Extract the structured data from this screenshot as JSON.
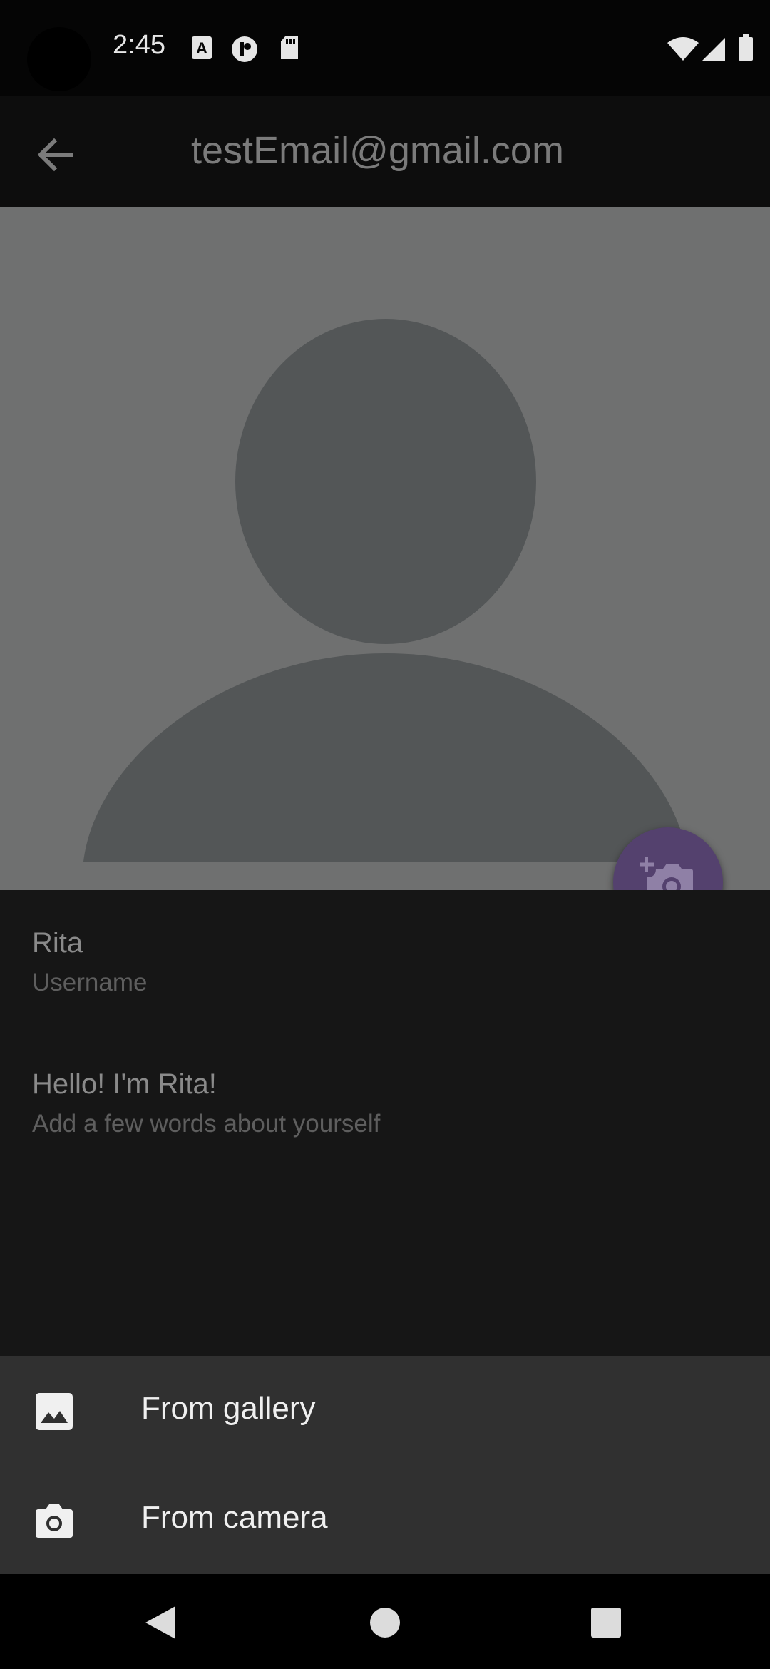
{
  "status_bar": {
    "time": "2:45",
    "icons": [
      "a-notification-icon",
      "f-notification-icon",
      "sd-card-icon",
      "wifi-icon",
      "signal-icon",
      "battery-icon"
    ]
  },
  "app_bar": {
    "title": "testEmail@gmail.com",
    "back_icon": "arrow-back-icon"
  },
  "profile": {
    "avatar_icon": "person-placeholder-icon",
    "fab_icon": "add-photo-icon",
    "username_value": "Rita",
    "username_label": "Username",
    "bio_value": "Hello! I'm Rita!",
    "bio_label": "Add a few words about yourself"
  },
  "bottom_sheet": {
    "items": [
      {
        "label": "From gallery",
        "icon": "image-icon"
      },
      {
        "label": "From camera",
        "icon": "camera-icon"
      }
    ]
  },
  "nav_bar": {
    "icons": [
      "nav-back-icon",
      "nav-home-icon",
      "nav-recents-icon"
    ]
  },
  "colors": {
    "photo_bg": "#6f7070",
    "avatar": "#535657",
    "fab": "#54416e",
    "sheet": "#303030",
    "info_bg": "#161616"
  }
}
